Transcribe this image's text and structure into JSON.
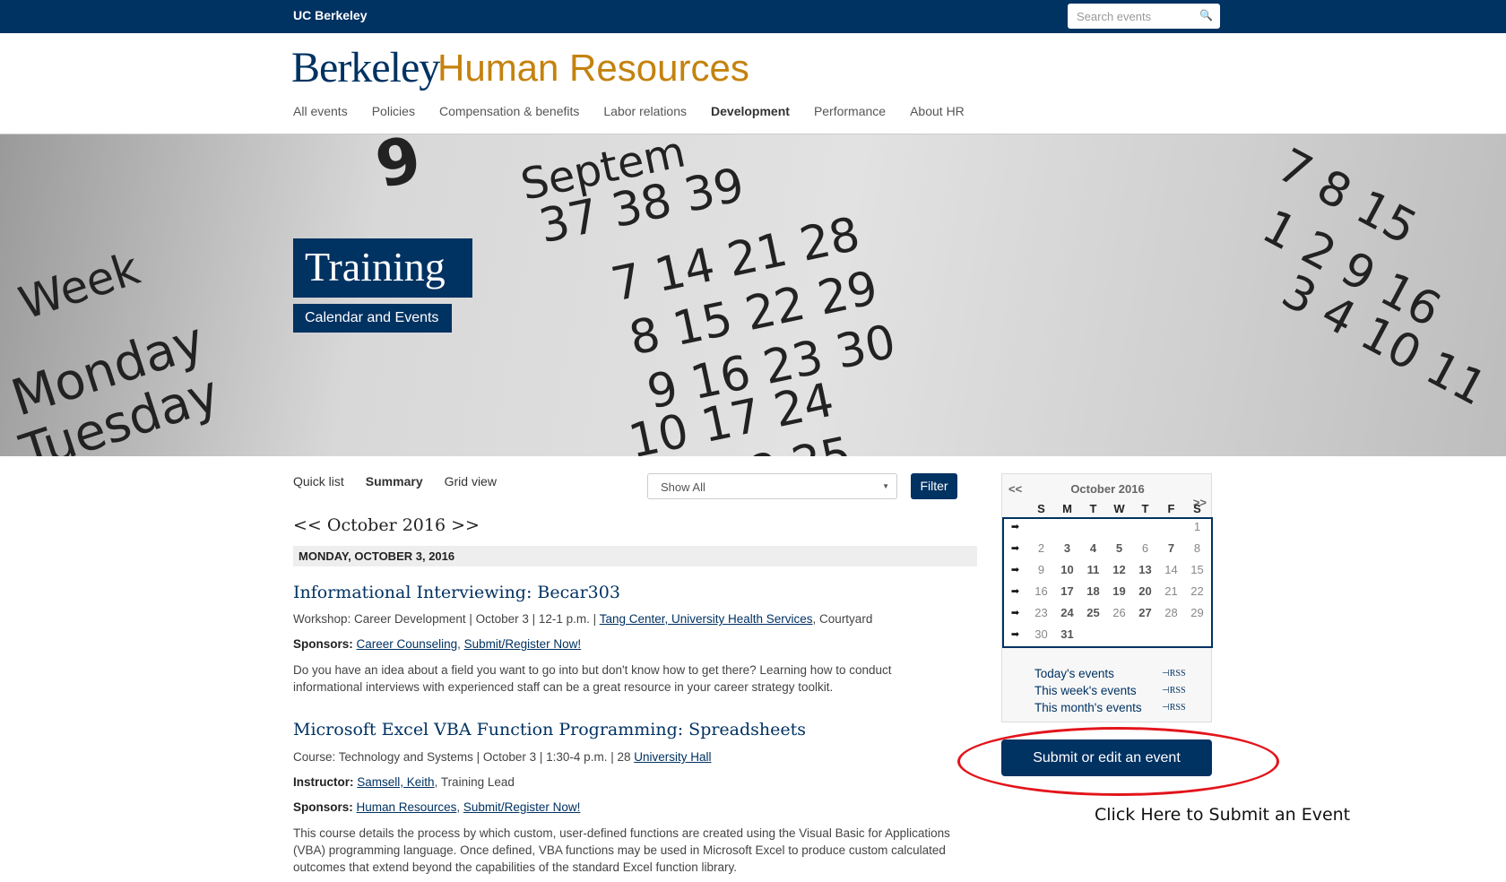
{
  "topbar": {
    "brand": "UC Berkeley",
    "search_placeholder": "Search events",
    "search_icon": "magnifier-icon"
  },
  "logo": {
    "part1": "Berkeley",
    "part2": "Human Resources"
  },
  "nav": [
    "All events",
    "Policies",
    "Compensation & benefits",
    "Labor relations",
    "Development",
    "Performance",
    "About HR"
  ],
  "nav_active": "Development",
  "hero": {
    "title": "Training",
    "subtitle": "Calendar and Events"
  },
  "views": {
    "tabs": [
      "Quick list",
      "Summary",
      "Grid view"
    ],
    "active": "Summary",
    "select_value": "Show All",
    "filter_label": "Filter"
  },
  "month_nav": "<< October 2016 >>",
  "date_header": "MONDAY, OCTOBER 3, 2016",
  "events": [
    {
      "title": "Informational Interviewing: Becar303",
      "meta": "Workshop: Career Development | October 3 | 12-1 p.m. | ",
      "location_link": "Tang Center, University Health Services",
      "location_rest": ", Courtyard",
      "sponsors_label": "Sponsors:",
      "sponsor_links": [
        "Career Counseling",
        "Submit/Register Now!"
      ],
      "description": "Do you have an idea about a field you want to go into but don't know how to get there? Learning how to conduct informational interviews with experienced staff can be a great resource in your career strategy toolkit."
    },
    {
      "title": "Microsoft Excel VBA Function Programming: Spreadsheets",
      "meta": "Course: Technology and Systems | October 3 | 1:30-4 p.m. | 28 ",
      "location_link": "University Hall",
      "instructor_label": "Instructor:",
      "instructor_link": "Samsell, Keith",
      "instructor_rest": ", Training Lead",
      "sponsors_label": "Sponsors:",
      "sponsor_links": [
        "Human Resources",
        "Submit/Register Now!"
      ],
      "description": "This course details the process by which custom, user-defined functions are created using the Visual Basic for Applications (VBA) programming language. Once defined, VBA functions may be used in Microsoft Excel to produce custom calculated outcomes that extend beyond the capabilities of the standard Excel function library."
    }
  ],
  "calendar": {
    "prev": "<<",
    "next": ">>",
    "title": "October 2016",
    "weekdays": [
      "S",
      "M",
      "T",
      "W",
      "T",
      "F",
      "S"
    ],
    "weeks": [
      [
        "",
        "",
        "",
        "",
        "",
        "",
        "1"
      ],
      [
        "2",
        "3",
        "4",
        "5",
        "6",
        "7",
        "8"
      ],
      [
        "9",
        "10",
        "11",
        "12",
        "13",
        "14",
        "15"
      ],
      [
        "16",
        "17",
        "18",
        "19",
        "20",
        "21",
        "22"
      ],
      [
        "23",
        "24",
        "25",
        "26",
        "27",
        "28",
        "29"
      ],
      [
        "30",
        "31",
        "",
        "",
        "",
        "",
        ""
      ]
    ],
    "event_days": [
      "3",
      "4",
      "5",
      "7",
      "10",
      "11",
      "12",
      "13",
      "17",
      "18",
      "19",
      "20",
      "24",
      "25",
      "27",
      "31"
    ],
    "links": [
      "Today's events",
      "This week's events",
      "This month's events"
    ],
    "rss_label": "RSS"
  },
  "submit_label": "Submit or edit an event",
  "annotation": "Click Here to Submit an Event",
  "colors": {
    "navy": "#003262",
    "gold": "#c4820e",
    "annotation_red": "#e3141b"
  }
}
